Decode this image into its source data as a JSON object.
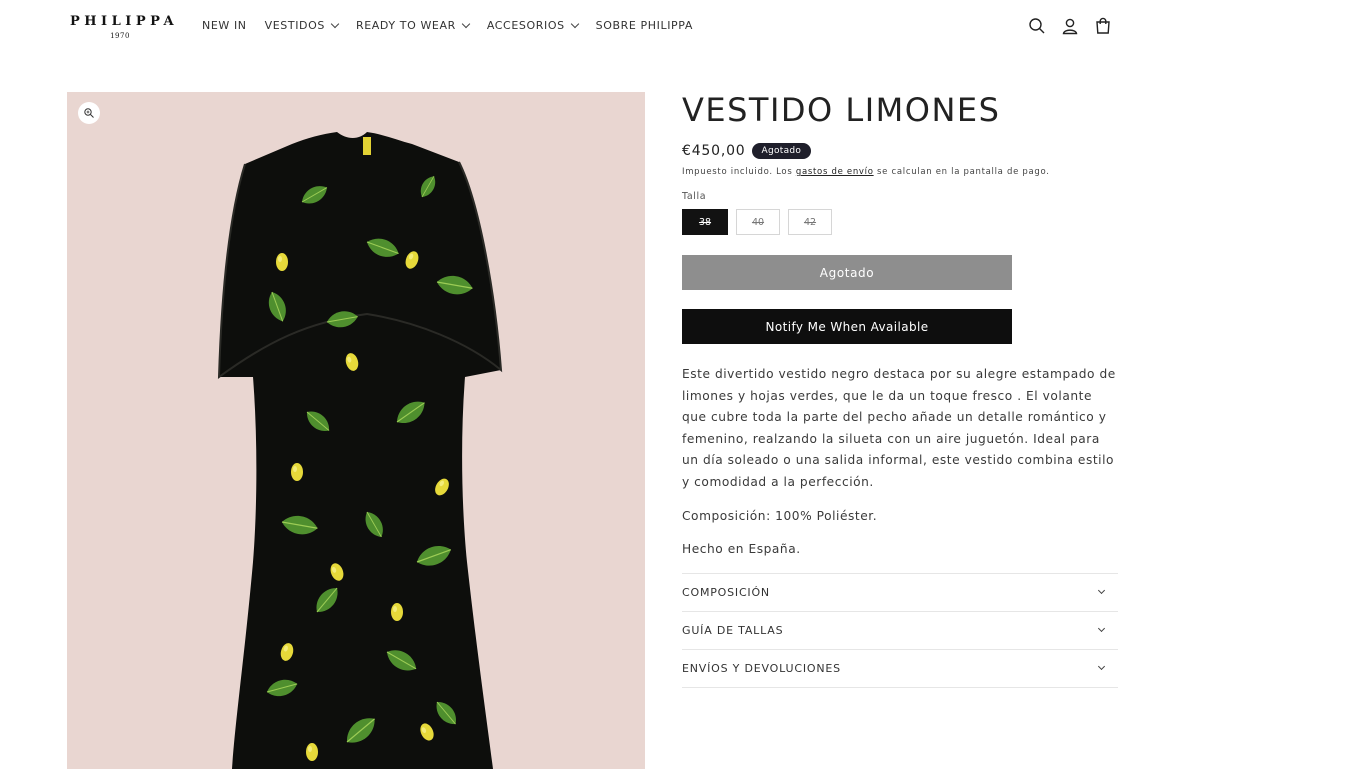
{
  "brand": {
    "name": "PHILIPPA",
    "year": "1970"
  },
  "nav": [
    {
      "label": "NEW IN",
      "has_dropdown": false
    },
    {
      "label": "VESTIDOS",
      "has_dropdown": true
    },
    {
      "label": "READY TO WEAR",
      "has_dropdown": true
    },
    {
      "label": "ACCESORIOS",
      "has_dropdown": true
    },
    {
      "label": "SOBRE PHILIPPA",
      "has_dropdown": false
    }
  ],
  "header_icons": [
    "search-icon",
    "account-icon",
    "cart-icon"
  ],
  "product": {
    "title": "VESTIDO LIMONES",
    "price": "€450,00",
    "badge": "Agotado",
    "tax_prefix": "Impuesto incluido. Los ",
    "tax_link": "gastos de envío",
    "tax_suffix": " se calculan en la pantalla de pago.",
    "size_label": "Talla",
    "sizes": [
      "38",
      "40",
      "42"
    ],
    "selected_size": "38",
    "soldout_button": "Agotado",
    "notify_button": "Notify Me When Available",
    "description": "Este divertido vestido negro destaca por su alegre estampado de limones y hojas verdes, que le da un toque fresco . El volante que cubre toda la parte del pecho añade un detalle romántico y femenino, realzando la silueta con un aire juguetón. Ideal para un día soleado o una salida informal, este vestido combina estilo y comodidad a la perfección.",
    "composition": "Composición: 100% Poliéster.",
    "made_in": "Hecho en España."
  },
  "accordions": [
    "COMPOSICIÓN",
    "GUÍA DE TALLAS",
    "ENVÍOS Y DEVOLUCIONES"
  ],
  "colors": {
    "media_bg": "#e9d6d1",
    "badge_bg": "#1f1f2b",
    "soldout_bg": "#8e8e8e",
    "notify_bg": "#0e0e0e"
  }
}
